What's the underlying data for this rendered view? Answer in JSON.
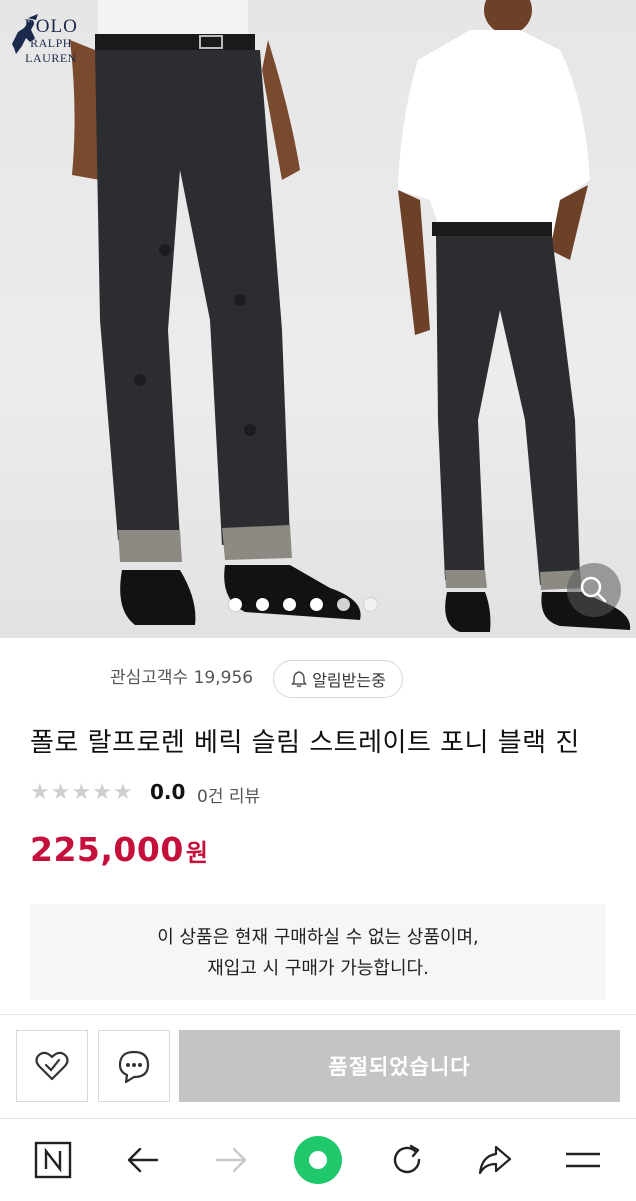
{
  "hero": {
    "brand_line1": "POLO",
    "brand_line2": "RALPH LAUREN",
    "slide_count": 6,
    "active_slide": 4
  },
  "product": {
    "watchers_label": "관심고객수 19,956",
    "alert_label": "알림받는중",
    "title": "폴로 랄프로렌 베릭 슬림 스트레이트 포니 블랙 진",
    "rating": "0.0",
    "review_count": "0건 리뷰",
    "price": "225,000",
    "currency": "원",
    "notice_line1": "이 상품은 현재 구매하실 수 없는 상품이며,",
    "notice_line2": "재입고 시 구매가 가능합니다.",
    "price_color": "#c4103a"
  },
  "actions": {
    "soldout_label": "품절되었습니다"
  },
  "browser_nav": {
    "icons": [
      "naver-n-icon",
      "back-arrow-icon",
      "forward-arrow-icon",
      "green-home-icon",
      "refresh-icon",
      "share-icon",
      "menu-icon"
    ]
  }
}
